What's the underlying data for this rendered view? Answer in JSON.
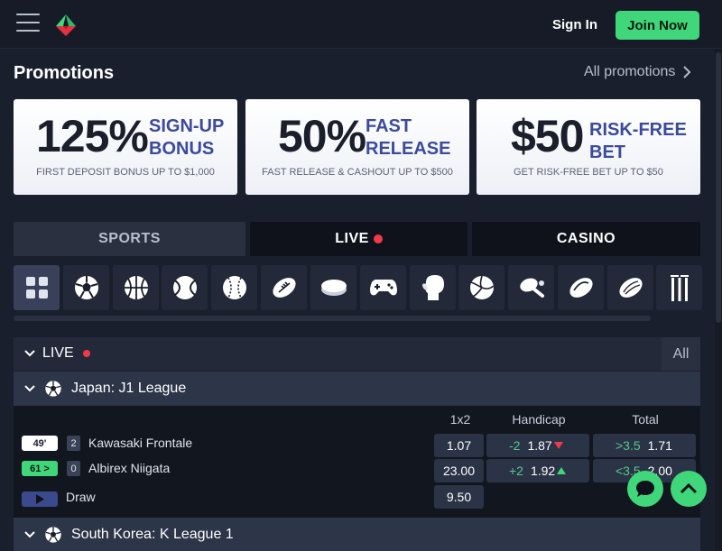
{
  "header": {
    "signin": "Sign In",
    "join": "Join Now"
  },
  "promotions": {
    "title": "Promotions",
    "all_link": "All promotions",
    "cards": [
      {
        "big": "125%",
        "side1": "SIGN-UP",
        "side2": "BONUS",
        "fine": "FIRST DEPOSIT BONUS UP TO $1,000"
      },
      {
        "big": "50%",
        "side1": "FAST",
        "side2": "RELEASE",
        "fine": "FAST RELEASE & CASHOUT UP TO $500"
      },
      {
        "big": "$50",
        "side1": "RISK-FREE",
        "side2": "BET",
        "fine": "GET RISK-FREE BET UP TO $50"
      }
    ]
  },
  "tabs": {
    "sports": "SPORTS",
    "live": "LIVE",
    "casino": "CASINO"
  },
  "sport_icons": [
    "grid-icon",
    "soccer-icon",
    "basketball-icon",
    "tennis-icon",
    "baseball-icon",
    "american-football-icon",
    "hockey-puck-icon",
    "gamepad-icon",
    "boxing-glove-icon",
    "volleyball-icon",
    "ping-pong-icon",
    "rugby-icon",
    "aussie-rules-icon",
    "cricket-icon"
  ],
  "live": {
    "label": "LIVE",
    "all": "All",
    "leagues": [
      {
        "name": "Japan: J1 League"
      },
      {
        "name": "South Korea: K League 1"
      }
    ],
    "columns": {
      "c1": "1x2",
      "c2": "Handicap",
      "c3": "Total"
    },
    "match": {
      "time": "49'",
      "status": "61 >",
      "home": {
        "score": "2",
        "name": "Kawasaki Frontale"
      },
      "away": {
        "score": "0",
        "name": "Albirex Niigata"
      },
      "draw_label": "Draw",
      "odds": {
        "home_1x2": "1.07",
        "away_1x2": "23.00",
        "draw_1x2": "9.50",
        "home_hcp_line": "-2",
        "home_hcp": "1.87",
        "away_hcp_line": "+2",
        "away_hcp": "1.92",
        "over_line": ">3.5",
        "over": "1.71",
        "under_line": "<3.5",
        "under": "2.00"
      }
    }
  },
  "colors": {
    "accent": "#3fd77a",
    "live_dot": "#ef3b4a",
    "bg": "#1a1f2e"
  }
}
